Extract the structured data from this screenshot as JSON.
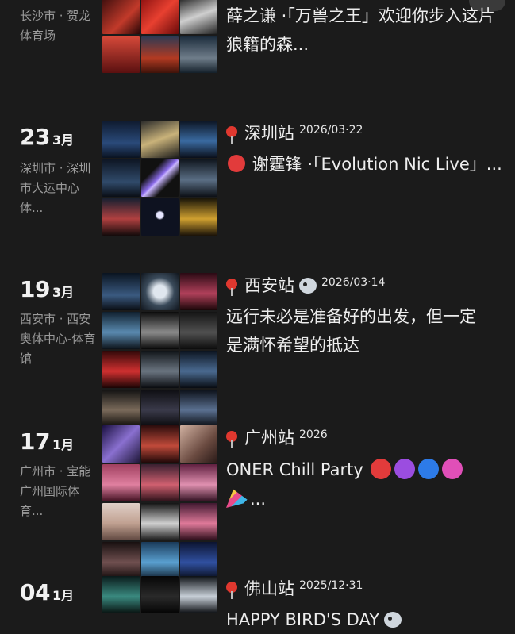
{
  "entries": [
    {
      "day": "",
      "month": "",
      "location": "长沙市 · 贺龙体育场",
      "title": "",
      "body": "薛之谦 ·「万兽之王」欢迎你步入这片狼籍的森..."
    },
    {
      "day": "23",
      "month": "3月",
      "location": "深圳市 · 深圳市大运中心体...",
      "title": "深圳站",
      "post_date": "2026/03·22",
      "body": "谢霆锋 ·「Evolution Nic Live」..."
    },
    {
      "day": "19",
      "month": "3月",
      "location": "西安市 · 西安奥体中心-体育馆",
      "title": "西安站",
      "post_date": "2026/03·14",
      "body": "远行未必是准备好的出发，但一定是满怀希望的抵达"
    },
    {
      "day": "17",
      "month": "1月",
      "location": "广州市 · 宝能广州国际体育...",
      "title": "广州站",
      "post_date": "2026",
      "body": "ONER Chill Party",
      "body_tail": "..."
    },
    {
      "day": "04",
      "month": "1月",
      "location": "",
      "title": "佛山站",
      "post_date": "2025/12·31",
      "body": "HAPPY BIRD'S DAY"
    }
  ],
  "colors": {
    "background": "#1b1b1b",
    "location_text": "#9b9b9b",
    "heart_red": "#e23b3b",
    "heart_purple": "#9b4de0",
    "heart_blue": "#2d7be8",
    "heart_pink": "#e04fb8"
  }
}
